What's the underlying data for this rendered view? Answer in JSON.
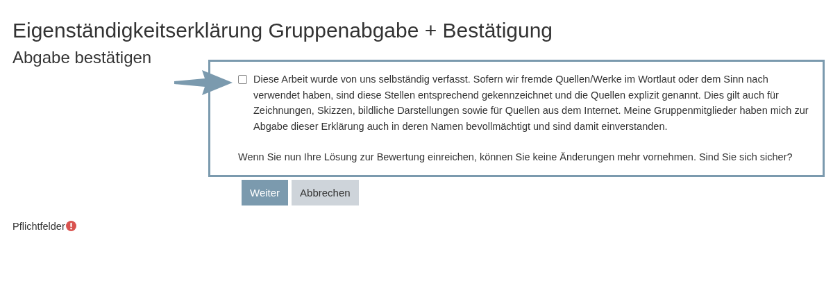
{
  "title": "Eigenständigkeitserklärung Gruppenabgabe + Bestätigung",
  "subtitle": "Abgabe bestätigen",
  "declaration": {
    "checked": false,
    "text": "Diese Arbeit wurde von uns selbständig verfasst. Sofern wir fremde Quellen/Werke im Wortlaut oder dem Sinn nach verwendet haben, sind diese Stellen entsprechend gekennzeichnet und die Quellen explizit genannt. Dies gilt auch für Zeichnungen, Skizzen, bildliche Darstellungen sowie für Quellen aus dem Internet. Meine Gruppenmitglieder haben mich zur Abgabe dieser Erklärung auch in deren Namen bevollmächtigt und sind damit einverstanden."
  },
  "notice": "Wenn Sie nun Ihre Lösung zur Bewertung einreichen, können Sie keine Änderungen mehr vornehmen. Sind Sie sich sicher?",
  "buttons": [
    {
      "label": "Weiter",
      "kind": "primary"
    },
    {
      "label": "Abbrechen",
      "kind": "secondary"
    }
  ],
  "required_note": "Pflichtfelder"
}
